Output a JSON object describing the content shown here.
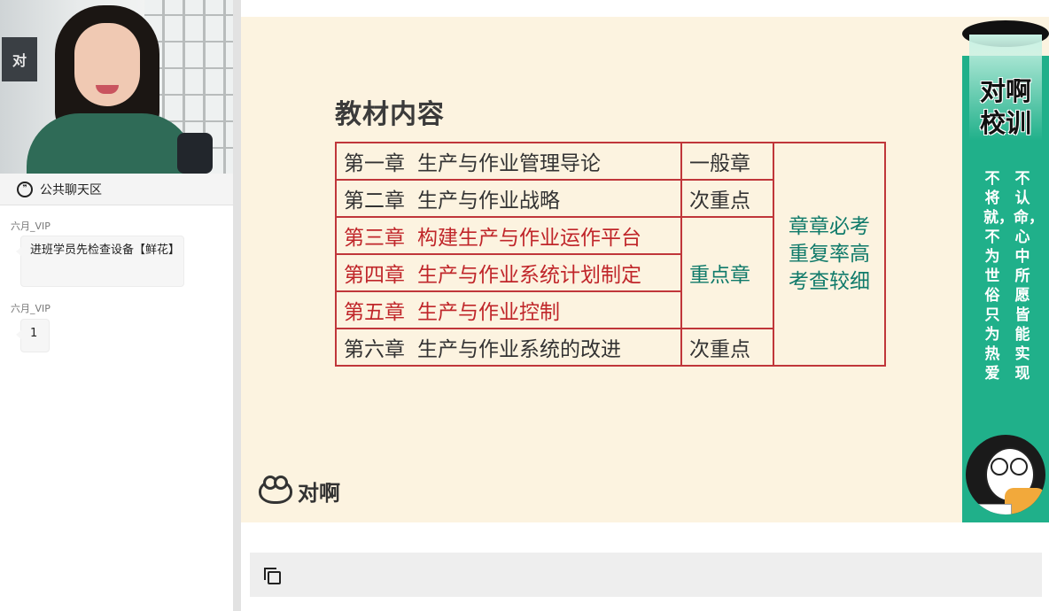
{
  "chat": {
    "header_title": "公共聊天区",
    "messages": [
      {
        "user": "六月_VIP",
        "text": "进班学员先检查设备【鲜花】"
      },
      {
        "user": "六月_VIP",
        "text": "1"
      }
    ]
  },
  "slide": {
    "title": "教材内容",
    "rows": [
      {
        "num": "第一章",
        "name": "生产与作业管理导论",
        "level": "一般章",
        "key": false
      },
      {
        "num": "第二章",
        "name": "生产与作业战略",
        "level": "次重点",
        "key": false
      },
      {
        "num": "第三章",
        "name": "构建生产与作业运作平台",
        "level": "",
        "key": true
      },
      {
        "num": "第四章",
        "name": "生产与作业系统计划制定",
        "level": "重点章",
        "key": true
      },
      {
        "num": "第五章",
        "name": "生产与作业控制",
        "level": "",
        "key": true
      },
      {
        "num": "第六章",
        "name": "生产与作业系统的改进",
        "level": "次重点",
        "key": false
      }
    ],
    "note_lines": [
      "章章必考",
      "重复率高",
      "考查较细"
    ],
    "logo_text": "对啊",
    "banner": {
      "brand_lines": [
        "对啊",
        "校训"
      ],
      "slogan_col1": "不认命，心中所愿皆能实现",
      "slogan_col2": "不将就，不为世俗只为热爱"
    }
  },
  "video": {
    "wall_sign": "对"
  },
  "colors": {
    "slide_bg": "#fcf3e0",
    "table_border": "#c0363a",
    "key_chapter": "#c0262a",
    "teal": "#0f7a6a",
    "banner": "#20b08a"
  }
}
